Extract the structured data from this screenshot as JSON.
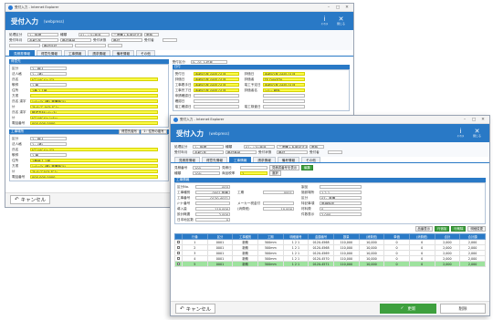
{
  "w1": {
    "browser_title": "受付入力 - Internet Explorer",
    "title": "受付入力",
    "subtitle": "(webpress)",
    "header_buttons": [
      {
        "glyph": "i",
        "label": "ｲﾝﾌｫﾒ"
      },
      {
        "glyph": "✕",
        "label": "閉じる"
      }
    ],
    "filter": {
      "rows": [
        [
          {
            "label": "処理区分",
            "value": "1：新規"
          },
          {
            "label": "種類",
            "value": "01：ｼｽﾃﾑ商品"
          },
          {
            "label": "",
            "value": "二重購入を許可する"
          },
          {
            "label": "",
            "value": "更新"
          }
        ],
        [
          {
            "label": "受付年月",
            "value": "令和2年"
          },
          {
            "label": "",
            "value": "受付番号"
          },
          {
            "label": "受付状態",
            "value": "受付"
          },
          {
            "label": "受付者",
            "value": ""
          }
        ],
        [
          {
            "label": "",
            "value": ""
          },
          {
            "label": "",
            "value": "受付日付"
          },
          {
            "label": "",
            "value": ""
          },
          {
            "label": "",
            "value": ""
          }
        ]
      ]
    },
    "tabs": [
      "見積書情報",
      "得意先情報",
      "工事情報",
      "請求情報",
      "備考情報",
      "その他"
    ],
    "customer": {
      "section": "得意先",
      "fields": [
        {
          "label": "区分",
          "value": "1：個人",
          "yellow": false
        },
        {
          "label": "法人格",
          "value": "1：(株)",
          "yellow": false
        },
        {
          "label": "氏名",
          "value": "ｶﾌﾞｼｷｶﾞｲｼｬ ﾃｽﾄ",
          "yellow": true
        },
        {
          "label": "敬称",
          "value": "1 様",
          "yellow": false
        },
        {
          "label": "住所",
          "value": "1番 1-1号",
          "yellow": true
        },
        {
          "label": "方書",
          "value": "",
          "yellow": true
        },
        {
          "label": "氏名 漢字",
          "value": "ｼｰﾃｨｰｱｲ (株) 事業所ｽﾃﾑ",
          "yellow": true
        },
        {
          "label": "ｶﾅ",
          "value": "ｽﾙｯﾃｨﾌﾞ ﾃｷｽﾄ ﾀﾞﾐｰ",
          "yellow": true
        },
        {
          "label": "氏名 漢字",
          "value": "株式会社ｼｰﾃｨｰｱｲ",
          "yellow": true
        },
        {
          "label": "ｶﾅ",
          "value": "ｶﾌﾞｼｷｶﾞｲｼｬ ｼｰﾃｨｰ",
          "yellow": true
        },
        {
          "label": "電話番号",
          "value": "000-000-0000",
          "yellow": true
        }
      ]
    },
    "construction": {
      "section": "工事場所",
      "buttons": [
        "得意先複写",
        "1：住所の複写"
      ],
      "fields": [
        {
          "label": "区分",
          "value": "1：個人",
          "yellow": false
        },
        {
          "label": "法人格",
          "value": "1：(株)",
          "yellow": false
        },
        {
          "label": "氏名",
          "value": "ｶﾌﾞｼｷｶﾞｲｼｬ ﾃｽﾄ",
          "yellow": true
        },
        {
          "label": "敬称",
          "value": "1 様",
          "yellow": false
        },
        {
          "label": "住所",
          "value": "1番地 1-1号",
          "yellow": true
        },
        {
          "label": "方書",
          "value": "ｼｰﾃｨｰｱｲ (株) 事業所ｽﾃﾑ",
          "yellow": true
        },
        {
          "label": "ｶﾅ",
          "value": "ｽﾙｯﾃｨﾌﾞﾃｷｽﾄ ﾀﾞﾐｰ",
          "yellow": true
        },
        {
          "label": "電話番号",
          "value": "000-000-0000",
          "yellow": true
        }
      ]
    },
    "dates": {
      "head_label": "受付区分",
      "head_value": "0：01 上位者",
      "section": "日付",
      "rows": [
        {
          "label": "受付日",
          "value": "令和02年 08月 01日",
          "label2": "評価日",
          "value2": "令和02年 08月 01日"
        },
        {
          "label": "評価日",
          "value": "令和02年 08月 01日",
          "label2": "評価者",
          "value2": "TE DAKETA"
        },
        {
          "label": "工事着手日",
          "value": "令和02年 08月 01日",
          "label2": "竣工予定日",
          "value2": "令和02年 08月 01日"
        },
        {
          "label": "工事完了日",
          "value": "令和02年 08月 01日",
          "label2": "評価者名",
          "value2": "ｼｰﾃｨｰ 統計"
        },
        {
          "label": "申請確認日",
          "value": "",
          "label2": "",
          "value2": ""
        },
        {
          "label": "確認日",
          "value": "",
          "label2": "",
          "value2": ""
        },
        {
          "label": "竣工確認日",
          "value": "",
          "label2": "竣工検査日",
          "value2": ""
        }
      ]
    },
    "cancel_label": "キャンセル",
    "cancel_icon": "return-arrow"
  },
  "w2": {
    "browser_title": "受付入力 - Internet Explorer",
    "title": "受付入力",
    "subtitle": "(webpress)",
    "header_buttons": [
      {
        "glyph": "i",
        "label": "ｲﾝﾌｫﾒ"
      },
      {
        "glyph": "✕",
        "label": "閉じる"
      }
    ],
    "filter": {
      "rows": [
        [
          {
            "label": "処理区分",
            "value": "1：新規"
          },
          {
            "label": "種類",
            "value": "01：ｼｽﾃﾑ商品"
          },
          {
            "label": "",
            "value": "二重購入を許可する"
          },
          {
            "label": "",
            "value": "更新"
          }
        ],
        [
          {
            "label": "受付年月",
            "value": "令和2年"
          },
          {
            "label": "",
            "value": "受付番号"
          },
          {
            "label": "受付状態",
            "value": "受付"
          },
          {
            "label": "受付者",
            "value": ""
          }
        ]
      ]
    },
    "tabs": [
      "見積書情報",
      "得意先情報",
      "工事情報",
      "請求情報",
      "備考情報",
      "その他"
    ],
    "active_tab": 2,
    "est": {
      "rows": [
        [
          {
            "label": "見積番号",
            "value": "100"
          },
          {
            "label": "見積日",
            "value": ""
          },
          {
            "label": "",
            "value": "見積書番号を表示"
          },
          {
            "label": "",
            "value": "編集"
          }
        ],
        [
          {
            "label": "種類",
            "value": "10%"
          },
          {
            "label": "商品税率",
            "value": "1"
          },
          {
            "label": "",
            "value": "選択"
          },
          {
            "label": "",
            "value": ""
          }
        ]
      ]
    },
    "detail_section": "工事情報",
    "detail": [
      {
        "label": "区分No.",
        "value": "003",
        "label2": "",
        "value2": "",
        "label3": "製品",
        "value3": ""
      },
      {
        "label": "工事種別",
        "value": "0001 新築",
        "label2": "工期",
        "value2": "0001",
        "label3": "施設場所",
        "value3": "1 2 1"
      },
      {
        "label": "工事番号",
        "value": "0120-4071",
        "label2": "",
        "value2": "",
        "label3": "区分",
        "value3": "07：事業"
      },
      {
        "label": "ﾒｰｶｰ番号",
        "value": "",
        "label2": "メーカー税金付",
        "value2": "",
        "label3": "特記事項",
        "value3": "単価指定"
      },
      {
        "label": "導入量",
        "value": "110,000",
        "label2": "(消費税)",
        "value2": "10,000",
        "label3": "材料費",
        "value3": "0"
      },
      {
        "label": "設計概要",
        "value": "2,000",
        "label2": "",
        "value2": "",
        "label3": "件数表示",
        "value3": "2,000"
      },
      {
        "label": "日本地区数",
        "value": "0",
        "label2": "",
        "value2": "",
        "label3": "",
        "value3": ""
      }
    ],
    "table_buttons": [
      "品番表示",
      "行追加",
      "行削除",
      "明細変更"
    ],
    "table": {
      "headers": [
        "行番",
        "区分",
        "工事種別",
        "工期",
        "明細番号",
        "金額番号",
        "数量",
        "(消費税)",
        "単価",
        "(消費税)",
        "合計",
        "合計額"
      ],
      "rows": [
        [
          "1",
          "0001",
          "新築",
          "500mm",
          "1 2 1",
          "0120-4568",
          "110,000",
          "10,000",
          "0",
          "0",
          "2,000",
          "2,000"
        ],
        [
          "2",
          "0001",
          "新築",
          "500mm",
          "1 2 1",
          "0120-4568",
          "110,000",
          "10,000",
          "0",
          "0",
          "2,000",
          "2,000"
        ],
        [
          "3",
          "0001",
          "新築",
          "500mm",
          "1 2 1",
          "0120-4569",
          "110,000",
          "10,000",
          "0",
          "0",
          "2,000",
          "2,000"
        ],
        [
          "4",
          "0001",
          "新築",
          "500mm",
          "1 2 1",
          "0120-4570",
          "110,000",
          "10,000",
          "0",
          "0",
          "2,000",
          "2,000"
        ],
        [
          "5",
          "0001",
          "新築",
          "500mm",
          "1 2 1",
          "0120-4571",
          "110,000",
          "10,000",
          "0",
          "0",
          "2,000",
          "2,000"
        ]
      ],
      "selected_row": 4
    },
    "cancel_label": "キャンセル",
    "update_label": "更新",
    "delete_label": "削除",
    "colors": {
      "accent": "#2979c6",
      "required": "#fafa47",
      "selected": "#9ee29e",
      "update": "#3ea03e"
    }
  }
}
